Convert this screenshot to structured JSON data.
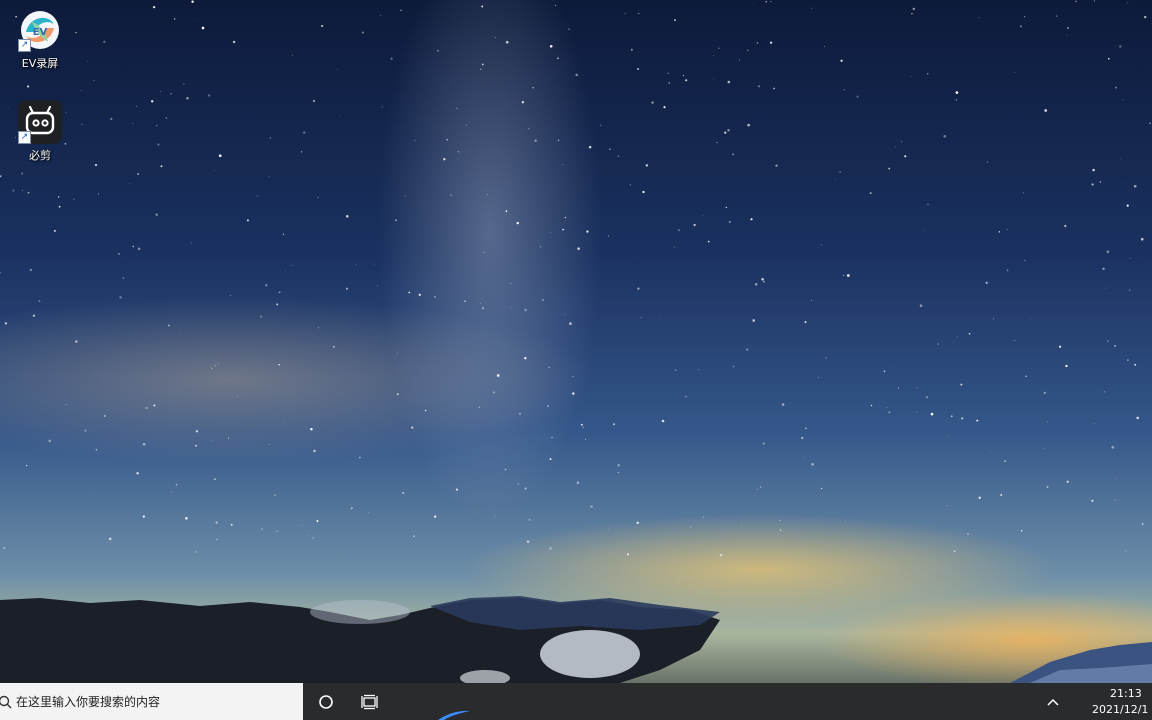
{
  "desktop": {
    "icons": [
      {
        "label": "EV录屏",
        "icon": "ev-recorder-icon"
      },
      {
        "label": "必剪",
        "icon": "bijian-editor-icon"
      }
    ]
  },
  "taskbar": {
    "search_placeholder": "在这里输入你要搜索的内容",
    "cortana_icon": "cortana-circle-icon",
    "task_view_icon": "task-view-icon",
    "tray_chevron_icon": "chevron-up-icon",
    "time": "21:13",
    "date": "2021/12/1"
  },
  "colors": {
    "taskbar_bg": "#2a2b2c",
    "search_bg": "#f3f3f3"
  }
}
